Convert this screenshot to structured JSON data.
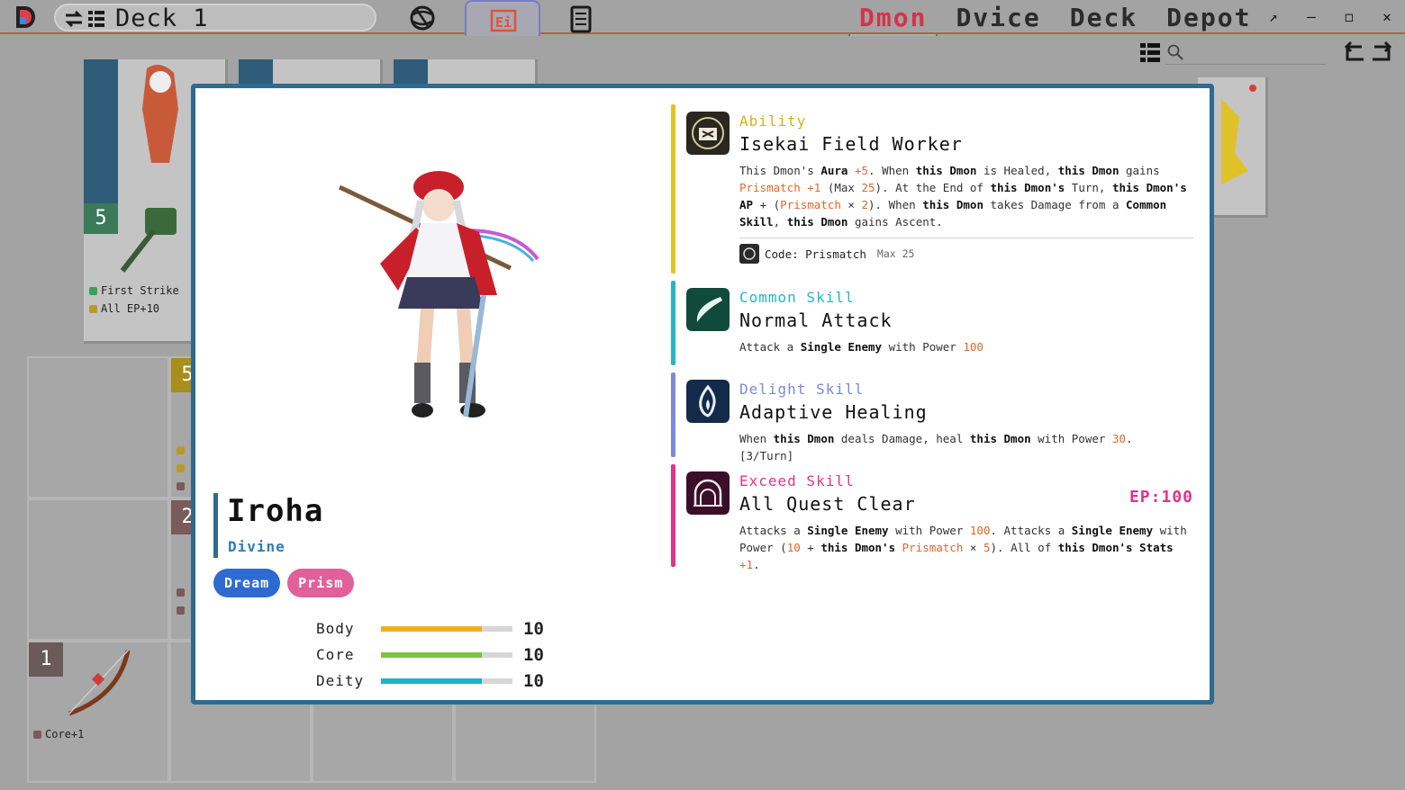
{
  "deck": {
    "title": "Deck 1"
  },
  "tabs": {
    "right": [
      "Dmon",
      "Dvice",
      "Deck",
      "Depot"
    ],
    "active": "Dmon"
  },
  "background": {
    "card1": {
      "level": "5",
      "tags": [
        "First Strike",
        "All EP+10"
      ]
    },
    "row2": {
      "level": "5"
    },
    "row3": {
      "level": "2"
    },
    "row4": {
      "level": "1",
      "tags": [
        "Core+1"
      ]
    }
  },
  "character": {
    "name": "Iroha",
    "class": "Divine",
    "tags": [
      {
        "label": "Dream",
        "color": "#2e6bd0"
      },
      {
        "label": "Prism",
        "color": "#e0609a"
      }
    ],
    "stats": [
      {
        "label": "Body",
        "value": "10",
        "fill": 0.77,
        "color": "#f0ae24"
      },
      {
        "label": "Core",
        "value": "10",
        "fill": 0.77,
        "color": "#7ac43c"
      },
      {
        "label": "Deity",
        "value": "10",
        "fill": 0.77,
        "color": "#1cb4c8"
      }
    ]
  },
  "skills": {
    "ability": {
      "kind": "Ability",
      "name": "Isekai Field Worker",
      "code_label": "Code: Prismatch",
      "code_max": "Max 25",
      "color": "#e3c321"
    },
    "common": {
      "kind": "Common Skill",
      "name": "Normal Attack",
      "color": "#25b6c6"
    },
    "delight": {
      "kind": "Delight Skill",
      "name": "Adaptive Healing",
      "color": "#7a8ae0"
    },
    "exceed": {
      "kind": "Exceed Skill",
      "name": "All Quest Clear",
      "ep": "EP:100",
      "color": "#e0338a"
    }
  },
  "colors": {
    "modal_border": "#2f6a90",
    "accent_orange": "#e0662a"
  }
}
